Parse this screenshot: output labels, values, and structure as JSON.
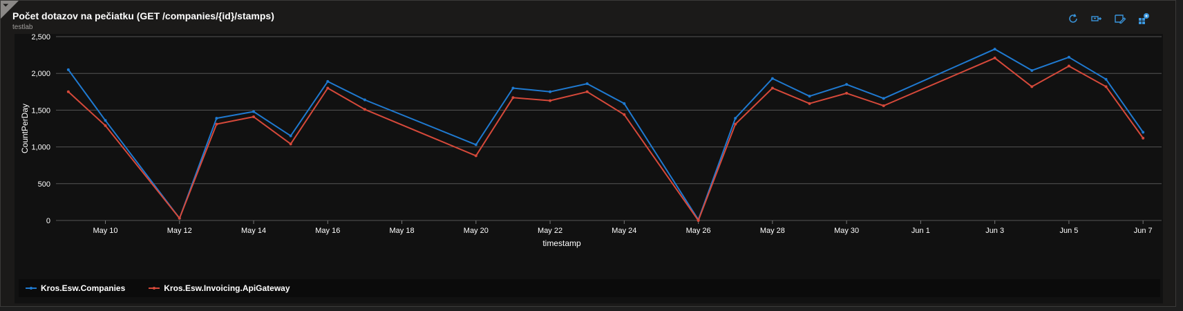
{
  "header": {
    "title": "Počet dotazov na pečiatku (GET /companies/{id}/stamps)",
    "subtitle": "testlab"
  },
  "toolbar": {
    "icons": [
      "refresh-icon",
      "pin-icon",
      "edit-icon",
      "dashboard-icon"
    ]
  },
  "legend": {
    "items": [
      {
        "label": "Kros.Esw.Companies",
        "color": "#1f7ad1"
      },
      {
        "label": "Kros.Esw.Invoicing.ApiGateway",
        "color": "#d6493a"
      }
    ]
  },
  "chart_data": {
    "type": "line",
    "xlabel": "timestamp",
    "ylabel": "CountPerDay",
    "ylim": [
      0,
      2500
    ],
    "yticks": [
      0,
      500,
      1000,
      1500,
      2000,
      2500
    ],
    "ytick_labels": [
      "0",
      "500",
      "1,000",
      "1,500",
      "2,000",
      "2,500"
    ],
    "xlim": [
      "2024-05-08T16:00",
      "2024-06-07T12:00"
    ],
    "xtick_labels": [
      "May 10",
      "May 12",
      "May 14",
      "May 16",
      "May 18",
      "May 20",
      "May 22",
      "May 24",
      "May 26",
      "May 28",
      "May 30",
      "Jun 1",
      "Jun 3",
      "Jun 5",
      "Jun 7"
    ],
    "xticks": [
      "2024-05-10",
      "2024-05-12",
      "2024-05-14",
      "2024-05-16",
      "2024-05-18",
      "2024-05-20",
      "2024-05-22",
      "2024-05-24",
      "2024-05-26",
      "2024-05-28",
      "2024-05-30",
      "2024-06-01",
      "2024-06-03",
      "2024-06-05",
      "2024-06-07"
    ],
    "grid": true,
    "legend_position": "bottom",
    "series": [
      {
        "name": "Kros.Esw.Companies",
        "color": "#1f7ad1",
        "points": [
          [
            "2024-05-09",
            2050
          ],
          [
            "2024-05-10",
            1360
          ],
          [
            "2024-05-12",
            30
          ],
          [
            "2024-05-13",
            1390
          ],
          [
            "2024-05-14",
            1480
          ],
          [
            "2024-05-15",
            1150
          ],
          [
            "2024-05-16",
            1890
          ],
          [
            "2024-05-17",
            1640
          ],
          [
            "2024-05-20",
            1030
          ],
          [
            "2024-05-21",
            1800
          ],
          [
            "2024-05-22",
            1750
          ],
          [
            "2024-05-23",
            1860
          ],
          [
            "2024-05-24",
            1590
          ],
          [
            "2024-05-26",
            10
          ],
          [
            "2024-05-27",
            1390
          ],
          [
            "2024-05-28",
            1930
          ],
          [
            "2024-05-29",
            1690
          ],
          [
            "2024-05-30",
            1850
          ],
          [
            "2024-05-31",
            1660
          ],
          [
            "2024-06-03",
            2330
          ],
          [
            "2024-06-04",
            2040
          ],
          [
            "2024-06-05",
            2220
          ],
          [
            "2024-06-06",
            1920
          ],
          [
            "2024-06-07",
            1200
          ]
        ]
      },
      {
        "name": "Kros.Esw.Invoicing.ApiGateway",
        "color": "#d6493a",
        "points": [
          [
            "2024-05-09",
            1750
          ],
          [
            "2024-05-10",
            1290
          ],
          [
            "2024-05-12",
            30
          ],
          [
            "2024-05-13",
            1310
          ],
          [
            "2024-05-14",
            1410
          ],
          [
            "2024-05-15",
            1040
          ],
          [
            "2024-05-16",
            1800
          ],
          [
            "2024-05-17",
            1510
          ],
          [
            "2024-05-20",
            880
          ],
          [
            "2024-05-21",
            1670
          ],
          [
            "2024-05-22",
            1630
          ],
          [
            "2024-05-23",
            1750
          ],
          [
            "2024-05-24",
            1440
          ],
          [
            "2024-05-26",
            0
          ],
          [
            "2024-05-27",
            1310
          ],
          [
            "2024-05-28",
            1800
          ],
          [
            "2024-05-29",
            1590
          ],
          [
            "2024-05-30",
            1730
          ],
          [
            "2024-05-31",
            1560
          ],
          [
            "2024-06-03",
            2210
          ],
          [
            "2024-06-04",
            1820
          ],
          [
            "2024-06-05",
            2100
          ],
          [
            "2024-06-06",
            1820
          ],
          [
            "2024-06-07",
            1120
          ]
        ]
      }
    ]
  }
}
